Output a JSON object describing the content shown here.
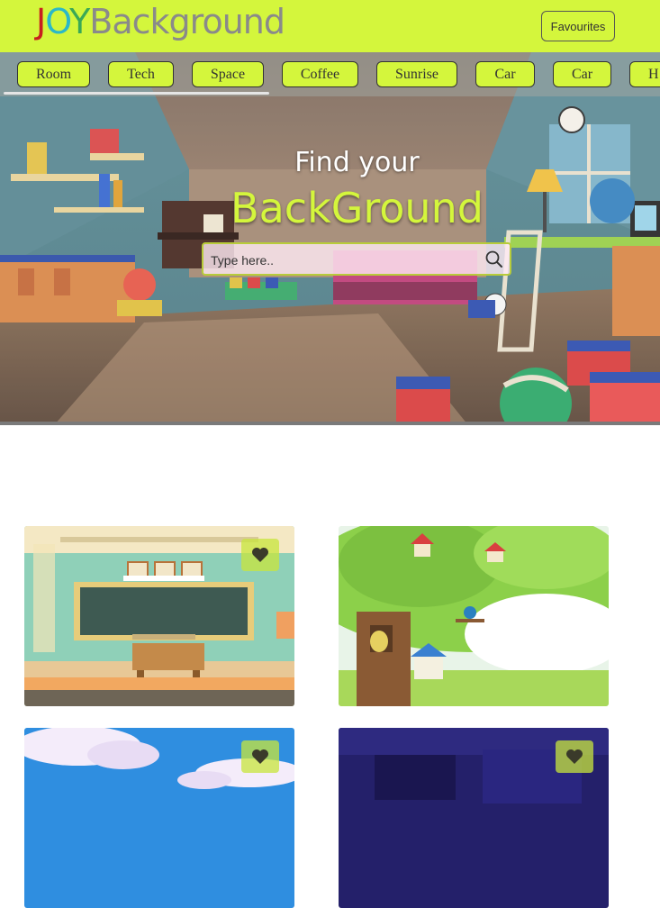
{
  "header": {
    "logo": {
      "j": "J",
      "o": "O",
      "y": "Y",
      "rest": "Background"
    },
    "favourites_label": "Favourites"
  },
  "categories": [
    "Room",
    "Tech",
    "Space",
    "Coffee",
    "Sunrise",
    "Car",
    "Car",
    "H"
  ],
  "hero": {
    "title_line1": "Find your",
    "title_line2": "BackGround",
    "search_placeholder": "Type here.."
  },
  "colors": {
    "accent": "#d4f63c",
    "header_bg": "#d4f63c",
    "logo_j": "#c81e1e",
    "logo_o": "#2bb8c8",
    "logo_y": "#3aa856",
    "logo_rest": "#8a8a8a"
  },
  "icons": {
    "search": "search-icon",
    "favourite": "heart-icon"
  }
}
